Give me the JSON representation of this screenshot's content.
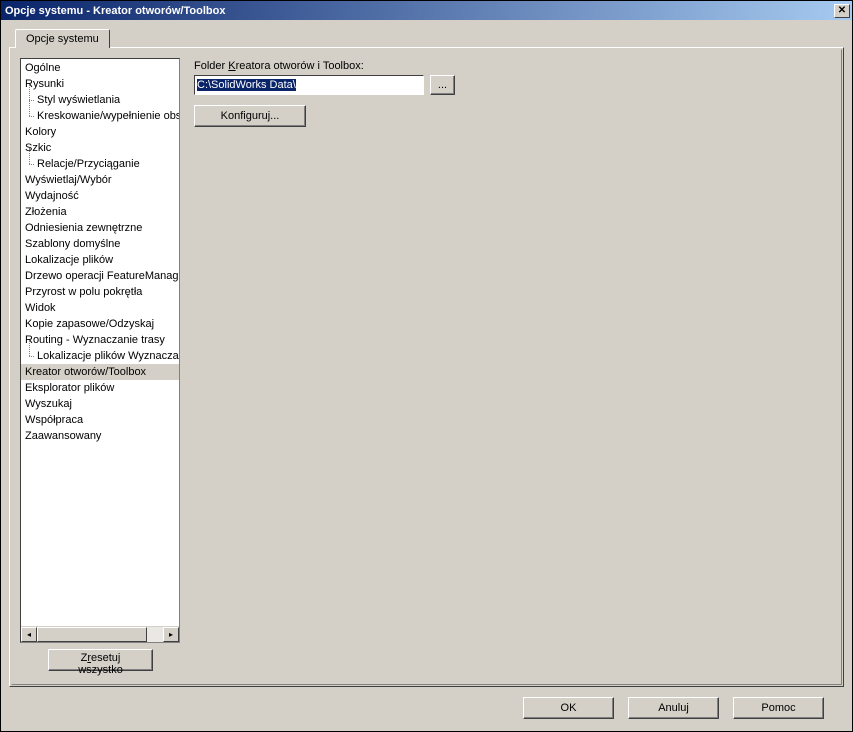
{
  "window": {
    "title": "Opcje systemu - Kreator otworów/Toolbox"
  },
  "tabs": {
    "system_options": "Opcje systemu"
  },
  "tree": {
    "items": [
      {
        "label": "Ogólne",
        "level": 0
      },
      {
        "label": "Rysunki",
        "level": 0
      },
      {
        "label": "Styl wyświetlania",
        "level": 1
      },
      {
        "label": "Kreskowanie/wypełnienie obszaru",
        "level": 1
      },
      {
        "label": "Kolory",
        "level": 0
      },
      {
        "label": "Szkic",
        "level": 0
      },
      {
        "label": "Relacje/Przyciąganie",
        "level": 1
      },
      {
        "label": "Wyświetlaj/Wybór",
        "level": 0
      },
      {
        "label": "Wydajność",
        "level": 0
      },
      {
        "label": "Złożenia",
        "level": 0
      },
      {
        "label": "Odniesienia zewnętrzne",
        "level": 0
      },
      {
        "label": "Szablony domyślne",
        "level": 0
      },
      {
        "label": "Lokalizacje plików",
        "level": 0
      },
      {
        "label": "Drzewo operacji FeatureManager",
        "level": 0
      },
      {
        "label": "Przyrost w polu pokrętła",
        "level": 0
      },
      {
        "label": "Widok",
        "level": 0
      },
      {
        "label": "Kopie zapasowe/Odzyskaj",
        "level": 0
      },
      {
        "label": "Routing - Wyznaczanie trasy",
        "level": 0
      },
      {
        "label": "Lokalizacje plików Wyznaczania trasy",
        "level": 1
      },
      {
        "label": "Kreator otworów/Toolbox",
        "level": 0,
        "selected": true
      },
      {
        "label": "Eksplorator plików",
        "level": 0
      },
      {
        "label": "Wyszukaj",
        "level": 0
      },
      {
        "label": "Współpraca",
        "level": 0
      },
      {
        "label": "Zaawansowany",
        "level": 0
      }
    ]
  },
  "right": {
    "folder_label_pre": "Folder ",
    "folder_label_hotkey": "K",
    "folder_label_post": "reatora otworów i Toolbox:",
    "folder_path": "C:\\SolidWorks Data\\",
    "browse_button": "...",
    "configure_button": "Konfiguruj..."
  },
  "buttons": {
    "reset_pre": "Z",
    "reset_hotkey": "r",
    "reset_post": "esetuj wszystko",
    "ok": "OK",
    "cancel": "Anuluj",
    "help": "Pomoc"
  }
}
